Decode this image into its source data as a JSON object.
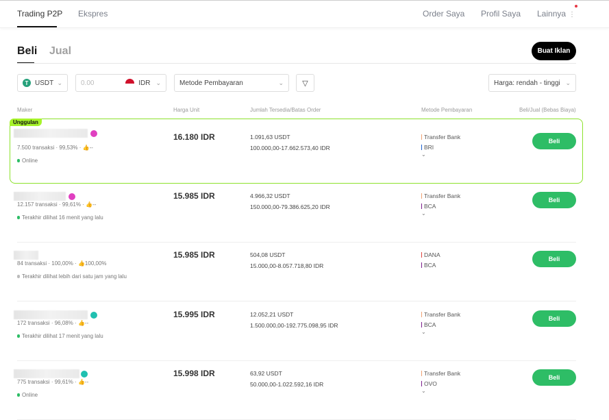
{
  "nav": {
    "tabs": [
      "Trading P2P",
      "Ekspres"
    ],
    "right": [
      "Order Saya",
      "Profil Saya",
      "Lainnya"
    ]
  },
  "side": {
    "buy": "Beli",
    "sell": "Jual"
  },
  "create_ad": "Buat Iklan",
  "filters": {
    "crypto": "USDT",
    "amount_placeholder": "0.00",
    "fiat": "IDR",
    "payment": "Metode Pembayaran",
    "sort": "Harga: rendah - tinggi"
  },
  "columns": [
    "Maker",
    "Harga Unit",
    "Jumlah Tersedia/Batas Order",
    "Metode Pembayaran",
    "Beli/Jual (Bebas Biaya)"
  ],
  "featured_label": "Unggulan",
  "colors": {
    "accent": "#2ebd66",
    "highlight": "#8be22a"
  },
  "rows": [
    {
      "orders": "7.500 transaksi",
      "completion": "99,53%",
      "like": "--",
      "status": "Online",
      "online": true,
      "badge": "pink",
      "price": "16.180 IDR",
      "available": "1.091,63 USDT",
      "limit": "100.000,00-17.662.573,40 IDR",
      "methods": [
        "Transfer Bank",
        "BRI"
      ],
      "more": true,
      "action": "Beli"
    },
    {
      "orders": "12.157 transaksi",
      "completion": "99,61%",
      "like": "--",
      "status": "Terakhir dilihat 16 menit yang lalu",
      "online": true,
      "badge": "pink",
      "price": "15.985 IDR",
      "available": "4.966,32 USDT",
      "limit": "150.000,00-79.386.625,20 IDR",
      "methods": [
        "Transfer Bank",
        "BCA"
      ],
      "more": true,
      "action": "Beli"
    },
    {
      "orders": "84 transaksi",
      "completion": "100,00%",
      "like": "100,00%",
      "status": "Terakhir dilihat lebih dari satu jam yang lalu",
      "online": false,
      "badge": "",
      "price": "15.985 IDR",
      "available": "504,08 USDT",
      "limit": "15.000,00-8.057.718,80 IDR",
      "methods": [
        "DANA",
        "BCA"
      ],
      "more": false,
      "action": "Beli"
    },
    {
      "orders": "172 transaksi",
      "completion": "96,08%",
      "like": "--",
      "status": "Terakhir dilihat 17 menit yang lalu",
      "online": true,
      "badge": "teal",
      "price": "15.995 IDR",
      "available": "12.052,21 USDT",
      "limit": "1.500.000,00-192.775.098,95 IDR",
      "methods": [
        "Transfer Bank",
        "BCA"
      ],
      "more": true,
      "action": "Beli"
    },
    {
      "orders": "775 transaksi",
      "completion": "99,61%",
      "like": "--",
      "status": "Online",
      "online": true,
      "badge": "teal",
      "price": "15.998 IDR",
      "available": "63,92 USDT",
      "limit": "50.000,00-1.022.592,16 IDR",
      "methods": [
        "Transfer Bank",
        "OVO"
      ],
      "more": true,
      "action": "Beli"
    }
  ]
}
